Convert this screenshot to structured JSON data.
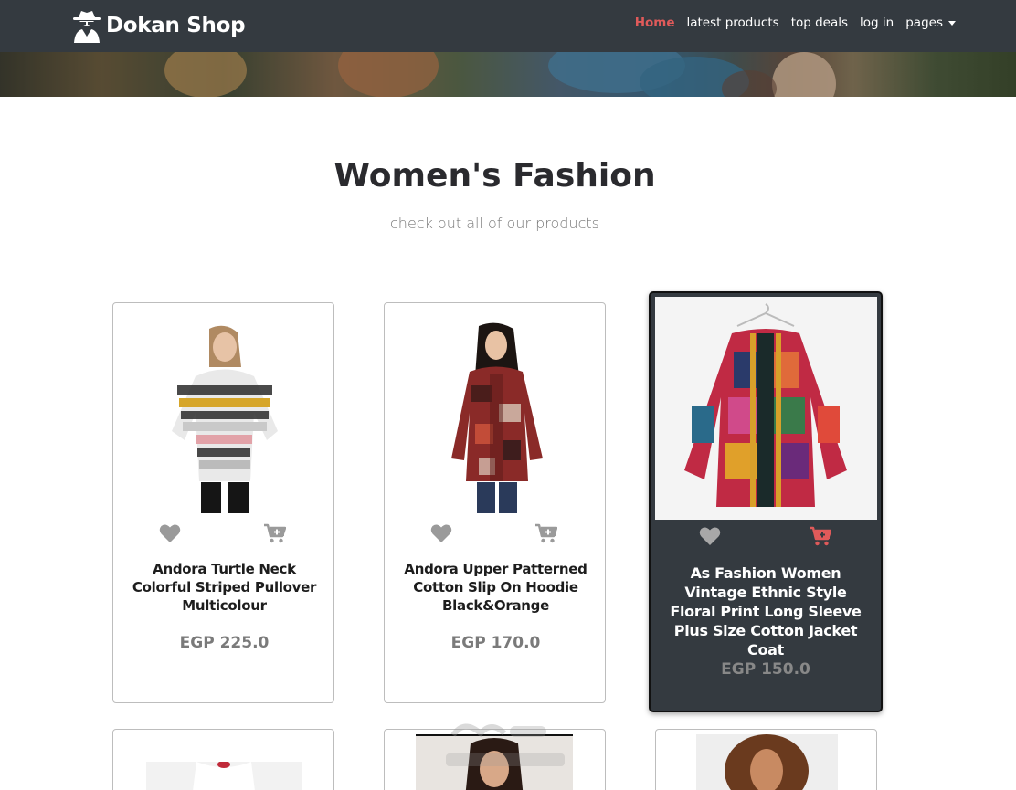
{
  "brand": {
    "name": "Dokan Shop",
    "logo_icon": "spy-icon"
  },
  "nav": {
    "items": [
      {
        "label": "Home",
        "active": true
      },
      {
        "label": "latest products",
        "active": false
      },
      {
        "label": "top deals",
        "active": false
      },
      {
        "label": "log in",
        "active": false
      },
      {
        "label": "pages",
        "active": false,
        "dropdown": true
      }
    ]
  },
  "section": {
    "title": "Women's Fashion",
    "subtitle": "check out all of our products"
  },
  "products": [
    {
      "name": "Andora Turtle Neck Colorful Striped Pullover Multicolour",
      "price": "EGP 225.0",
      "highlighted": false
    },
    {
      "name": "Andora Upper Patterned Cotton Slip On Hoodie Black&Orange",
      "price": "EGP 170.0",
      "highlighted": false
    },
    {
      "name": "As Fashion Women Vintage Ethnic Style Floral Print Long Sleeve Plus Size Cotton Jacket Coat",
      "price": "EGP 150.0",
      "highlighted": true
    }
  ],
  "icons": {
    "wishlist": "heart-icon",
    "cart": "cart-plus-icon"
  },
  "colors": {
    "accent": "#e05a5a",
    "navbar": "#343a40",
    "icon_gray": "#9a9a9a"
  }
}
